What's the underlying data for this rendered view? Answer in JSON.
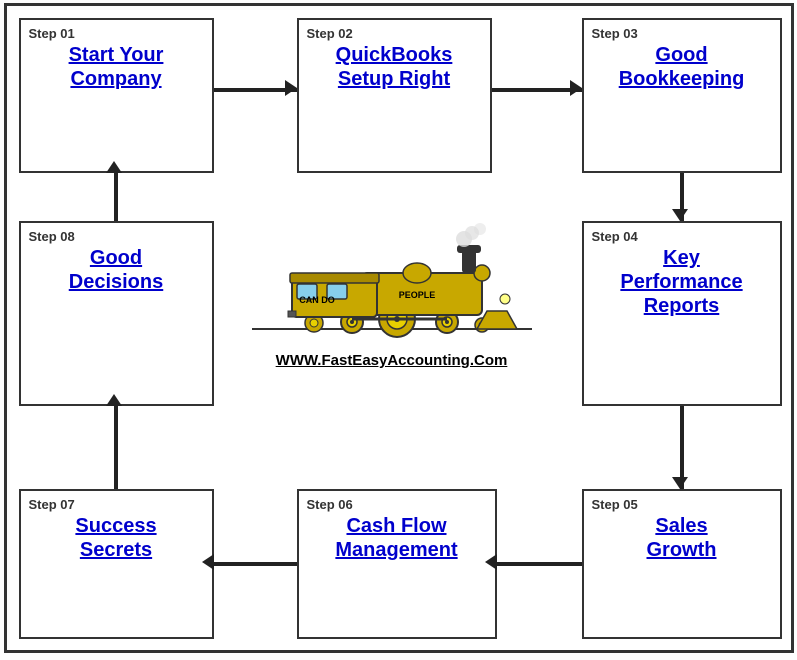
{
  "steps": [
    {
      "id": "s1",
      "label": "Step 01",
      "title": "Start Your\nCompany"
    },
    {
      "id": "s2",
      "label": "Step 02",
      "title": "QuickBooks\nSetup Right"
    },
    {
      "id": "s3",
      "label": "Step 03",
      "title": "Good\nBookkeeping"
    },
    {
      "id": "s4",
      "label": "Step 04",
      "title": "Key\nPerformance\nReports"
    },
    {
      "id": "s5",
      "label": "Step 05",
      "title": "Sales\nGrowth"
    },
    {
      "id": "s6",
      "label": "Step 06",
      "title": "Cash Flow\nManagement"
    },
    {
      "id": "s7",
      "label": "Step 07",
      "title": "Success\nSecrets"
    },
    {
      "id": "s8",
      "label": "Step 08",
      "title": "Good\nDecisions"
    }
  ],
  "website": "WWW.FastEasyAccounting.Com"
}
